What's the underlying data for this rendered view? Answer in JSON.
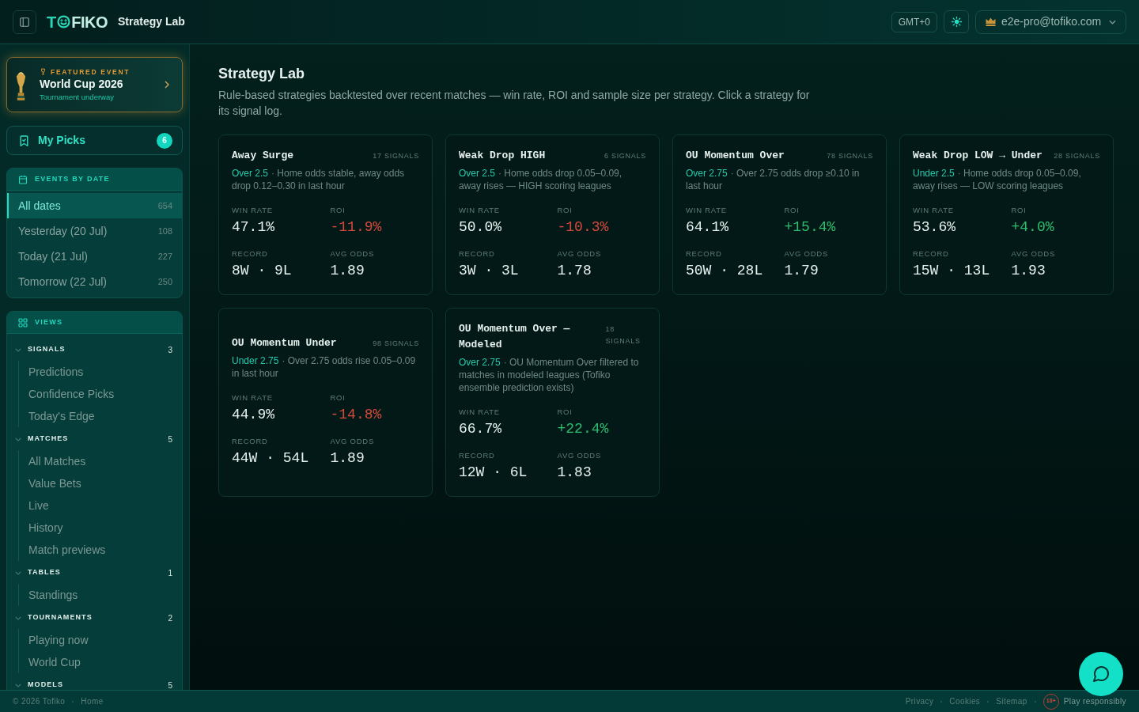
{
  "header": {
    "logo": {
      "lead": "T",
      "tail": "FIKO"
    },
    "page_title": "Strategy Lab",
    "timezone": "GMT+0",
    "user_email": "e2e-pro@tofiko.com"
  },
  "sidebar": {
    "featured_event": {
      "eyebrow": "FEATURED EVENT",
      "title": "World Cup 2026",
      "status": "Tournament underway"
    },
    "my_picks": {
      "label": "My Picks",
      "count": "6"
    },
    "events_by_date": {
      "title": "EVENTS BY DATE",
      "items": [
        {
          "label": "All dates",
          "count": "654",
          "selected": true
        },
        {
          "label": "Yesterday (20 Jul)",
          "count": "108",
          "selected": false
        },
        {
          "label": "Today (21 Jul)",
          "count": "227",
          "selected": false
        },
        {
          "label": "Tomorrow (22 Jul)",
          "count": "250",
          "selected": false
        }
      ]
    },
    "views": {
      "title": "VIEWS",
      "groups": [
        {
          "label": "SIGNALS",
          "count": "3",
          "expanded": true,
          "children": [
            {
              "label": "Predictions",
              "selected": false
            },
            {
              "label": "Confidence Picks",
              "selected": false
            },
            {
              "label": "Today's Edge",
              "selected": false
            }
          ]
        },
        {
          "label": "MATCHES",
          "count": "5",
          "expanded": true,
          "children": [
            {
              "label": "All Matches",
              "selected": false
            },
            {
              "label": "Value Bets",
              "selected": false
            },
            {
              "label": "Live",
              "selected": false
            },
            {
              "label": "History",
              "selected": false
            },
            {
              "label": "Match previews",
              "selected": false
            }
          ]
        },
        {
          "label": "TABLES",
          "count": "1",
          "expanded": true,
          "children": [
            {
              "label": "Standings",
              "selected": false
            }
          ]
        },
        {
          "label": "TOURNAMENTS",
          "count": "2",
          "expanded": true,
          "children": [
            {
              "label": "Playing now",
              "selected": false
            },
            {
              "label": "World Cup",
              "selected": false
            }
          ]
        },
        {
          "label": "MODELS",
          "count": "5",
          "expanded": true
        }
      ]
    }
  },
  "main": {
    "title": "Strategy Lab",
    "description": "Rule-based strategies backtested over recent matches — win rate, ROI and sample size per strategy. Click a strategy for its signal log.",
    "strategies": [
      {
        "name": "Away Surge",
        "signals": "17 SIGNALS",
        "market": "Over 2.5",
        "rule": "· Home odds stable, away odds drop 0.12–0.30 in last hour",
        "stats": [
          {
            "label": "WIN RATE",
            "value": "47.1%"
          },
          {
            "label": "ROI",
            "value": "-11.9%",
            "negative": true
          },
          {
            "label": "RECORD",
            "value": "8W · 9L"
          },
          {
            "label": "AVG ODDS",
            "value": "1.89"
          }
        ]
      },
      {
        "name": "Weak Drop HIGH",
        "signals": "6 SIGNALS",
        "market": "Over 2.5",
        "rule": "· Home odds drop 0.05–0.09, away rises — HIGH scoring leagues",
        "stats": [
          {
            "label": "WIN RATE",
            "value": "50.0%"
          },
          {
            "label": "ROI",
            "value": "-10.3%",
            "negative": true
          },
          {
            "label": "RECORD",
            "value": "3W · 3L"
          },
          {
            "label": "AVG ODDS",
            "value": "1.78"
          }
        ]
      },
      {
        "name": "OU Momentum Over",
        "signals": "78 SIGNALS",
        "market": "Over 2.75",
        "rule": "· Over 2.75 odds drop ≥0.10 in last hour",
        "stats": [
          {
            "label": "WIN RATE",
            "value": "64.1%"
          },
          {
            "label": "ROI",
            "value": "+15.4%",
            "negative": false
          },
          {
            "label": "RECORD",
            "value": "50W · 28L"
          },
          {
            "label": "AVG ODDS",
            "value": "1.79"
          }
        ]
      },
      {
        "name": "Weak Drop LOW → Under",
        "signals": "28 SIGNALS",
        "market": "Under 2.5",
        "rule": "· Home odds drop 0.05–0.09, away rises — LOW scoring leagues",
        "stats": [
          {
            "label": "WIN RATE",
            "value": "53.6%"
          },
          {
            "label": "ROI",
            "value": "+4.0%",
            "negative": false
          },
          {
            "label": "RECORD",
            "value": "15W · 13L"
          },
          {
            "label": "AVG ODDS",
            "value": "1.93"
          }
        ]
      },
      {
        "name": "OU Momentum Under",
        "signals": "98 SIGNALS",
        "market": "Under 2.75",
        "rule": "· Over 2.75 odds rise 0.05–0.09 in last hour",
        "stats": [
          {
            "label": "WIN RATE",
            "value": "44.9%"
          },
          {
            "label": "ROI",
            "value": "-14.8%",
            "negative": true
          },
          {
            "label": "RECORD",
            "value": "44W · 54L"
          },
          {
            "label": "AVG ODDS",
            "value": "1.89"
          }
        ]
      },
      {
        "name": "OU Momentum Over — Modeled",
        "signals": "18 SIGNALS",
        "market": "Over 2.75",
        "rule": "· OU Momentum Over filtered to matches in modeled leagues (Tofiko ensemble prediction exists)",
        "stats": [
          {
            "label": "WIN RATE",
            "value": "66.7%"
          },
          {
            "label": "ROI",
            "value": "+22.4%",
            "negative": false
          },
          {
            "label": "RECORD",
            "value": "12W · 6L"
          },
          {
            "label": "AVG ODDS",
            "value": "1.83"
          }
        ]
      }
    ]
  },
  "footer": {
    "copyright": "© 2026 Tofiko",
    "left_links": [
      "Home"
    ],
    "right_links": [
      "Privacy",
      "Cookies",
      "Sitemap"
    ],
    "age_badge": "18+",
    "responsible_note": "Play responsibly"
  }
}
